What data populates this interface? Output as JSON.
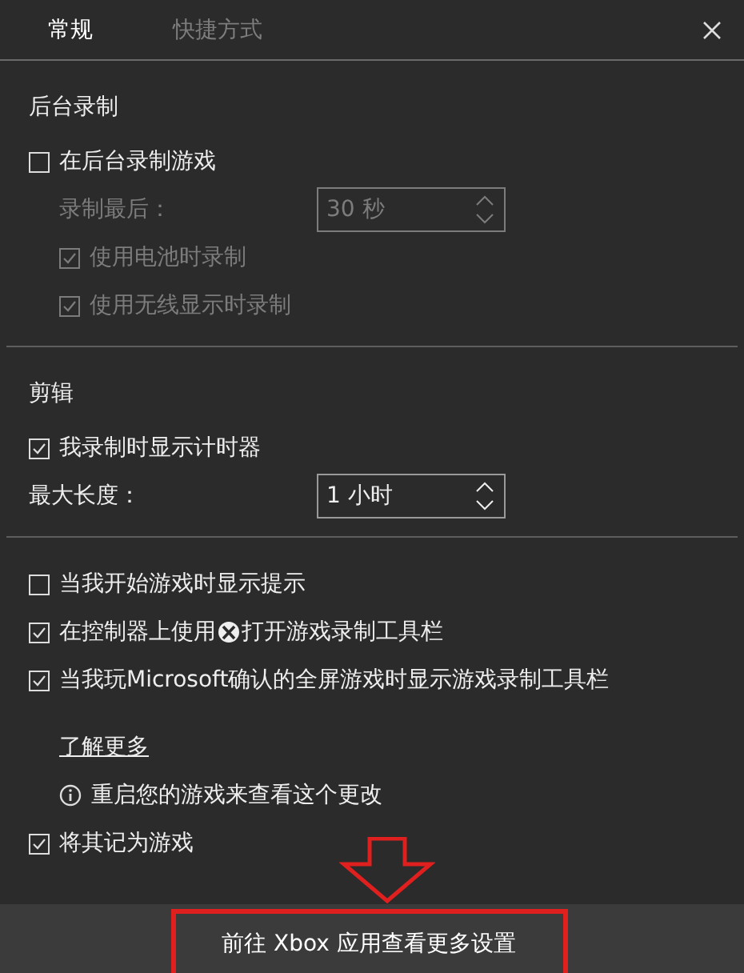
{
  "tabs": [
    {
      "label": "常规",
      "selected": true
    },
    {
      "label": "快捷方式",
      "selected": false
    }
  ],
  "sections": [
    {
      "heading": "后台录制",
      "items": [
        {
          "kind": "checkbox",
          "label": "在后台录制游戏",
          "checked": false,
          "disabled": false,
          "children": [
            {
              "kind": "spinner",
              "label": "录制最后：",
              "value": "30 秒",
              "disabled": true
            },
            {
              "kind": "checkbox",
              "label": "使用电池时录制",
              "checked": true,
              "disabled": true
            },
            {
              "kind": "checkbox",
              "label": "使用无线显示时录制",
              "checked": true,
              "disabled": true
            }
          ]
        }
      ]
    },
    {
      "heading": "剪辑",
      "items": [
        {
          "kind": "checkbox",
          "label": "我录制时显示计时器",
          "checked": true,
          "disabled": false
        },
        {
          "kind": "spinner",
          "label": "最大长度：",
          "value": "1 小时",
          "disabled": false
        }
      ]
    },
    {
      "items": [
        {
          "kind": "checkbox",
          "label": "当我开始游戏时显示提示",
          "checked": false,
          "disabled": false
        },
        {
          "kind": "checkbox",
          "label": "在控制器上使用",
          "label_after": "打开游戏录制工具栏",
          "checked": true,
          "disabled": false
        },
        {
          "kind": "checkbox",
          "label": "当我玩Microsoft确认的全屏游戏时显示游戏录制工具栏",
          "checked": true,
          "disabled": false
        },
        {
          "kind": "link",
          "label": "了解更多"
        },
        {
          "kind": "info",
          "label": "重启您的游戏来查看这个更改"
        },
        {
          "kind": "checkbox",
          "label": "将其记为游戏",
          "checked": true,
          "disabled": false
        }
      ]
    }
  ],
  "footer_button": "前往 Xbox 应用查看更多设置"
}
